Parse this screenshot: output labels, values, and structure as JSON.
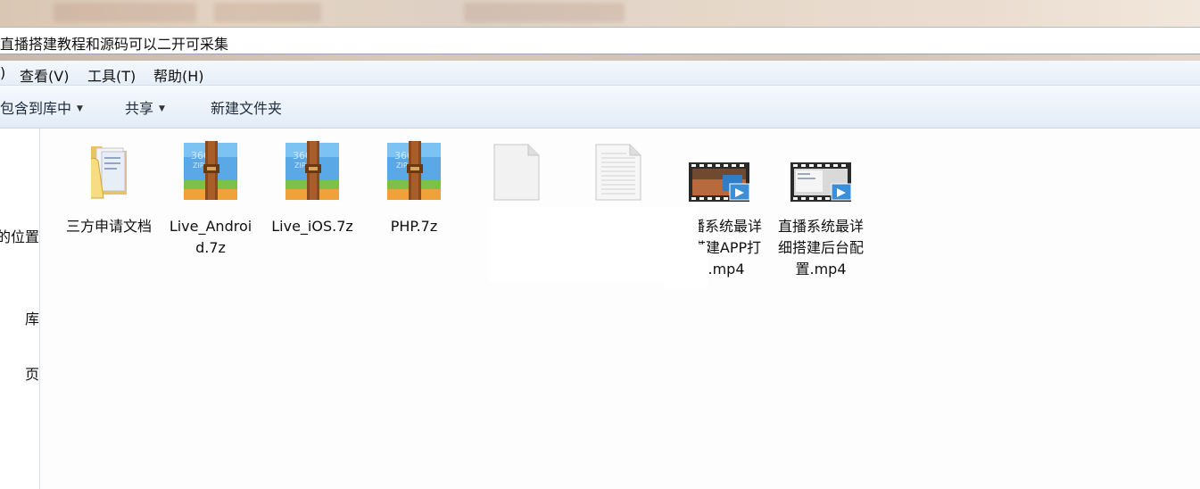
{
  "window": {
    "address_path": "直播搭建教程和源码可以二开可采集"
  },
  "menu": {
    "items": [
      {
        "label": ")"
      },
      {
        "label": "查看(V)"
      },
      {
        "label": "工具(T)"
      },
      {
        "label": "帮助(H)"
      }
    ]
  },
  "toolbar": {
    "include_library": "包含到库中",
    "share": "共享",
    "new_folder": "新建文件夹"
  },
  "nav_pane": {
    "items": [
      {
        "label": "的位置"
      },
      {
        "label": "库"
      },
      {
        "label": "页"
      }
    ]
  },
  "files": [
    {
      "label": "三方申请文档",
      "icon": "folder-icon"
    },
    {
      "label": "Live_Android.7z",
      "icon": "archive-7z-icon"
    },
    {
      "label": "Live_iOS.7z",
      "icon": "archive-7z-icon"
    },
    {
      "label": "PHP.7z",
      "icon": "archive-7z-icon"
    },
    {
      "label": "",
      "icon": "blank-file-icon"
    },
    {
      "label": "",
      "icon": "text-file-icon"
    },
    {
      "label": "直播系统最详细搭建APP打包.mp4",
      "icon": "video-file-icon"
    },
    {
      "label": "直播系统最详细搭建后台配置.mp4",
      "icon": "video-file-icon"
    }
  ]
}
